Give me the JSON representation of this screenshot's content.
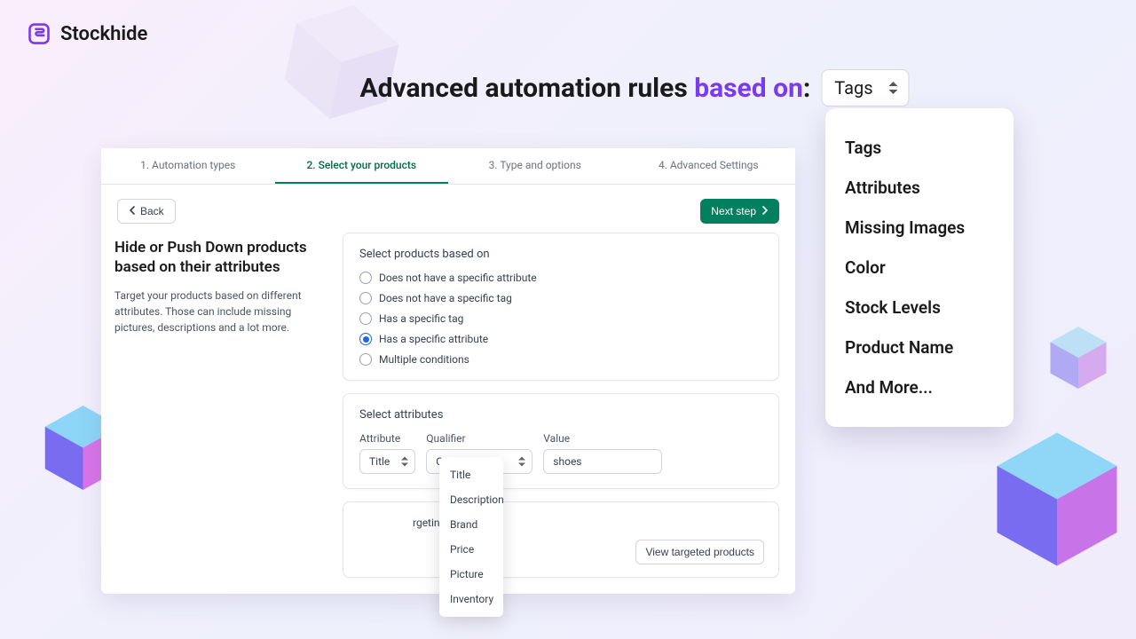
{
  "brand": {
    "name": "Stockhide"
  },
  "hero": {
    "prefix": "Advanced automation rules ",
    "accent": "based on",
    "suffix": ":",
    "selected": "Tags"
  },
  "mega": {
    "items": [
      "Tags",
      "Attributes",
      "Missing Images",
      "Color",
      "Stock Levels",
      "Product Name",
      "And More..."
    ]
  },
  "tabs": [
    {
      "label": "1. Automation types",
      "active": false
    },
    {
      "label": "2. Select your products",
      "active": true
    },
    {
      "label": "3. Type and options",
      "active": false
    },
    {
      "label": "4. Advanced Settings",
      "active": false
    }
  ],
  "toolbar": {
    "back": "Back",
    "next": "Next step"
  },
  "side": {
    "heading": "Hide or Push Down products based on their attributes",
    "description": "Target your products based on different attributes. Those can include missing pictures, descriptions and a lot more."
  },
  "panel1": {
    "title": "Select products based on",
    "options": [
      {
        "label": "Does not have a specific attribute",
        "checked": false
      },
      {
        "label": "Does not have a specific tag",
        "checked": false
      },
      {
        "label": "Has a specific tag",
        "checked": false
      },
      {
        "label": "Has a specific attribute",
        "checked": true
      },
      {
        "label": "Multiple conditions",
        "checked": false
      }
    ]
  },
  "panel2": {
    "title": "Select attributes",
    "fields": {
      "attribute_label": "Attribute",
      "qualifier_label": "Qualifier",
      "value_label": "Value",
      "attribute_value": "Title",
      "qualifier_value": "Contains",
      "value_input": "shoes"
    },
    "attribute_options": [
      "Title",
      "Description",
      "Brand",
      "Price",
      "Picture",
      "Inventory"
    ]
  },
  "panel3": {
    "partial_msg": "rgeting is selecting",
    "view_button": "View targeted products"
  }
}
